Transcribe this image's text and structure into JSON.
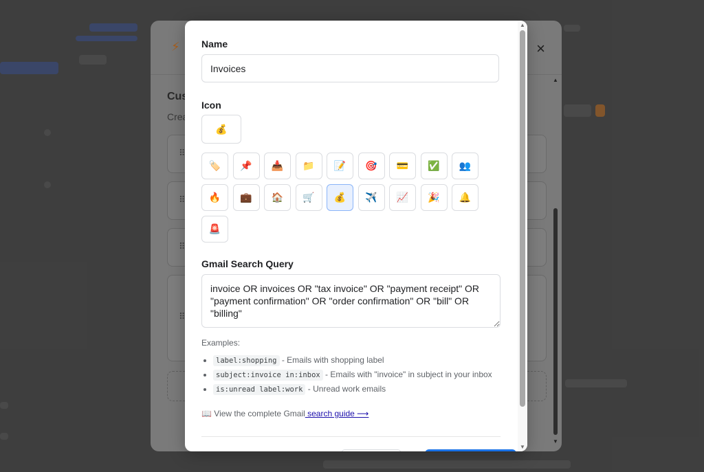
{
  "modal": {
    "name_label": "Name",
    "name_value": "Invoices",
    "icon_label": "Icon",
    "selected_icon": "💰",
    "icons": [
      "🏷️",
      "📌",
      "📥",
      "📁",
      "📝",
      "🎯",
      "💳",
      "✅",
      "👥",
      "🔥",
      "💼",
      "🏠",
      "🛒",
      "💰",
      "✈️",
      "📈",
      "🎉",
      "🔔",
      "🚨"
    ],
    "selected_index": 13,
    "query_label": "Gmail Search Query",
    "query_value": "invoice OR invoices OR \"tax invoice\" OR \"payment receipt\" OR \"payment confirmation\" OR \"order confirmation\" OR \"bill\" OR \"billing\"",
    "examples_title": "Examples:",
    "examples": [
      {
        "code": "label:shopping",
        "desc": " - Emails with shopping label"
      },
      {
        "code": "subject:invoice in:inbox",
        "desc": " - Emails with \"invoice\" in subject in your inbox"
      },
      {
        "code": "is:unread label:work",
        "desc": " - Unread work emails"
      }
    ],
    "guide_prefix": "📖 View the complete Gmail",
    "guide_link": " search guide ⟶"
  },
  "parent": {
    "close": "×",
    "icon": "⚡",
    "title_partial": "Cus",
    "subtitle_partial": "Crea"
  },
  "colors": {
    "accent": "#1a73e8",
    "selected_bg": "#e8f0fe",
    "border": "#dadce0"
  }
}
